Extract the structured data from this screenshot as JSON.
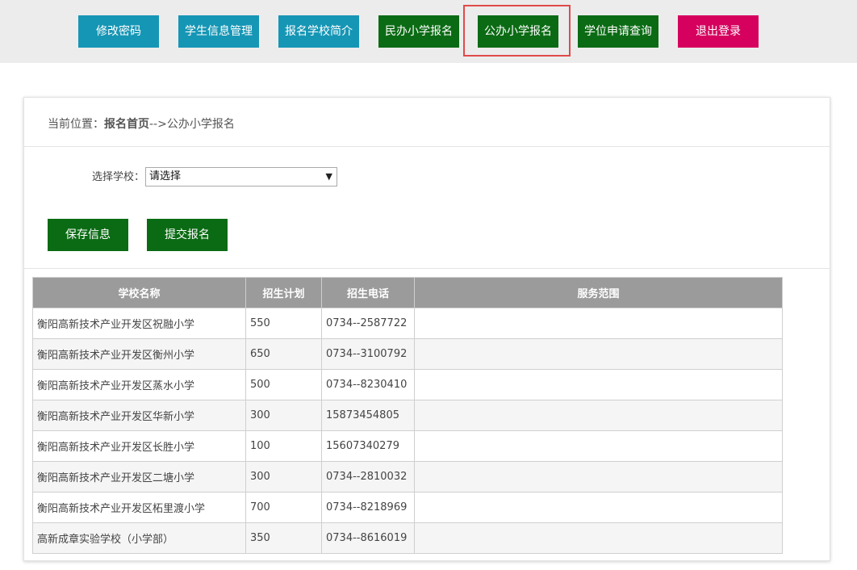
{
  "nav": {
    "items": [
      {
        "label": "修改密码"
      },
      {
        "label": "学生信息管理"
      },
      {
        "label": "报名学校简介"
      },
      {
        "label": "民办小学报名"
      },
      {
        "label": "公办小学报名"
      },
      {
        "label": "学位申请查询"
      },
      {
        "label": "退出登录"
      }
    ],
    "active": "公办小学报名"
  },
  "breadcrumb": {
    "prefix": "当前位置：",
    "home": "报名首页",
    "separator": "-->",
    "current": "公办小学报名"
  },
  "form": {
    "select_label": "选择学校：",
    "select_value": "请选择",
    "save_label": "保存信息",
    "submit_label": "提交报名"
  },
  "table": {
    "headers": [
      "学校名称",
      "招生计划",
      "招生电话",
      "服务范围"
    ],
    "rows": [
      {
        "name": "衡阳高新技术产业开发区祝融小学",
        "plan": "550",
        "phone": "0734--2587722",
        "scope": ""
      },
      {
        "name": "衡阳高新技术产业开发区衡州小学",
        "plan": "650",
        "phone": "0734--3100792",
        "scope": ""
      },
      {
        "name": "衡阳高新技术产业开发区蒸水小学",
        "plan": "500",
        "phone": "0734--8230410",
        "scope": ""
      },
      {
        "name": "衡阳高新技术产业开发区华新小学",
        "plan": "300",
        "phone": "15873454805",
        "scope": ""
      },
      {
        "name": "衡阳高新技术产业开发区长胜小学",
        "plan": "100",
        "phone": "15607340279",
        "scope": ""
      },
      {
        "name": "衡阳高新技术产业开发区二塘小学",
        "plan": "300",
        "phone": "0734--2810032",
        "scope": ""
      },
      {
        "name": "衡阳高新技术产业开发区柘里渡小学",
        "plan": "700",
        "phone": "0734--8218969",
        "scope": ""
      },
      {
        "name": "高新成章实验学校（小学部）",
        "plan": "350",
        "phone": "0734--8616019",
        "scope": ""
      }
    ]
  },
  "colors": {
    "teal": "#1696b5",
    "green": "#0b6b14",
    "pink": "#d6005e",
    "active_outline": "#e04a4a",
    "table_header": "#9b9b9b"
  }
}
